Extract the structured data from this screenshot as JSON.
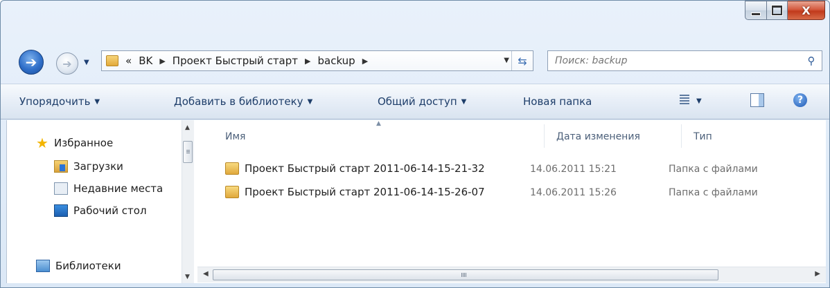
{
  "window": {
    "caption": {
      "minimize": "",
      "maximize": "",
      "close": "X"
    }
  },
  "nav": {
    "path_prefix": "«",
    "breadcrumbs": [
      "BK",
      "Проект Быстрый старт",
      "backup"
    ],
    "search_placeholder": "Поиск: backup"
  },
  "toolbar": {
    "organize": "Упорядочить",
    "add_to_library": "Добавить в библиотеку",
    "share": "Общий доступ",
    "new_folder": "Новая папка"
  },
  "navpane": {
    "favorites": "Избранное",
    "downloads": "Загрузки",
    "recent": "Недавние места",
    "desktop": "Рабочий стол",
    "libraries": "Библиотеки"
  },
  "filelist": {
    "columns": {
      "name": "Имя",
      "date": "Дата изменения",
      "type": "Тип"
    },
    "rows": [
      {
        "name": "Проект Быстрый старт 2011-06-14-15-21-32",
        "date": "14.06.2011 15:21",
        "type": "Папка с файлами"
      },
      {
        "name": "Проект Быстрый старт 2011-06-14-15-26-07",
        "date": "14.06.2011 15:26",
        "type": "Папка с файлами"
      }
    ]
  },
  "colors": {
    "accent": "#1e3e6a",
    "window_frame": "#dbe8f6",
    "close_button": "#c13a1c"
  },
  "icons": [
    "back-arrow-icon",
    "forward-arrow-icon",
    "folder-icon",
    "refresh-icon",
    "search-icon",
    "star-icon",
    "downloads-icon",
    "recent-places-icon",
    "desktop-icon",
    "libraries-icon",
    "views-icon",
    "preview-pane-icon",
    "help-icon"
  ]
}
